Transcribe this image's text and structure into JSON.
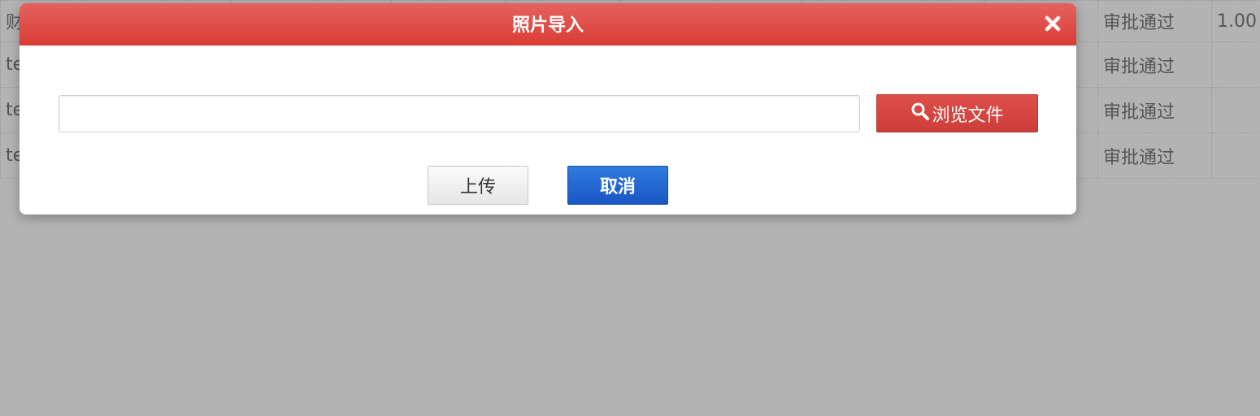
{
  "background_table": {
    "rows": [
      {
        "first": "财",
        "status": "审批通过",
        "value": "1.00"
      },
      {
        "first": "te",
        "status": "审批通过",
        "value": ""
      },
      {
        "first": "te",
        "status": "审批通过",
        "value": ""
      },
      {
        "first": "te",
        "status": "审批通过",
        "value": ""
      }
    ]
  },
  "dialog": {
    "title": "照片导入",
    "close_icon": "close-icon",
    "file_input": {
      "value": "",
      "placeholder": ""
    },
    "browse_button": {
      "label": "浏览文件",
      "icon": "search-icon"
    },
    "upload_button": {
      "label": "上传"
    },
    "cancel_button": {
      "label": "取消"
    }
  },
  "colors": {
    "header_red": "#d93c34",
    "browse_red": "#d44540",
    "cancel_blue": "#1f63d2",
    "overlay_gray": "#b3b3b3"
  }
}
